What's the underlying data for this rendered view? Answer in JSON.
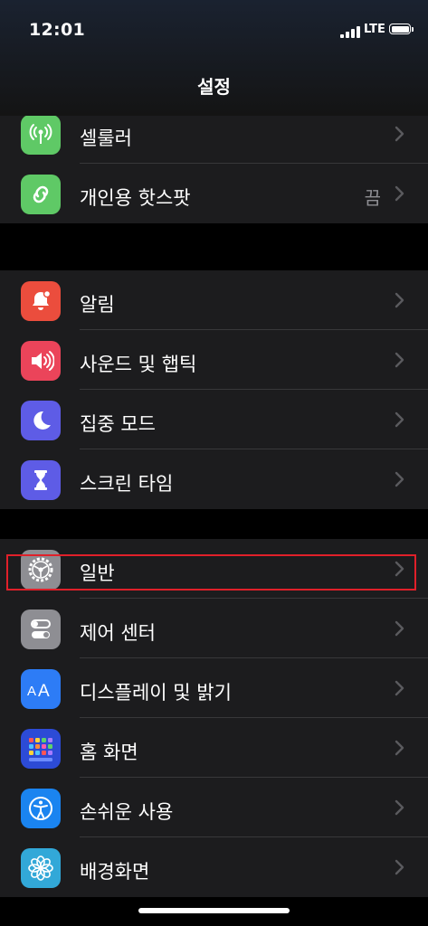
{
  "status_bar": {
    "time": "12:01",
    "network": "LTE"
  },
  "nav": {
    "title": "설정"
  },
  "group1": [
    {
      "label": "셀룰러",
      "icon": "antenna-icon",
      "color": "#5fc966"
    },
    {
      "label": "개인용 핫스팟",
      "value": "끔",
      "icon": "hotspot-link-icon",
      "color": "#5fc966"
    }
  ],
  "group2": [
    {
      "label": "알림",
      "icon": "bell-icon",
      "color": "#eb4d3d"
    },
    {
      "label": "사운드 및 햅틱",
      "icon": "speaker-icon",
      "color": "#eb445a"
    },
    {
      "label": "집중 모드",
      "icon": "moon-icon",
      "color": "#5e5ce6"
    },
    {
      "label": "스크린 타임",
      "icon": "hourglass-icon",
      "color": "#5e5ce6"
    }
  ],
  "group3": [
    {
      "label": "일반",
      "icon": "gear-icon",
      "color": "#8e8e93",
      "highlighted": true
    },
    {
      "label": "제어 센터",
      "icon": "toggles-icon",
      "color": "#8e8e93"
    },
    {
      "label": "디스플레이 및 밝기",
      "icon": "text-size-icon",
      "color": "#2d7cf6"
    },
    {
      "label": "홈 화면",
      "icon": "app-grid-icon",
      "color": "#2c4bd6"
    },
    {
      "label": "손쉬운 사용",
      "icon": "accessibility-icon",
      "color": "#1a84f0"
    },
    {
      "label": "배경화면",
      "icon": "flower-icon",
      "color": "#32a8d8"
    }
  ],
  "colors": {
    "highlight_border": "#e0202a",
    "background": "#000000",
    "cell": "#1c1c1e"
  }
}
